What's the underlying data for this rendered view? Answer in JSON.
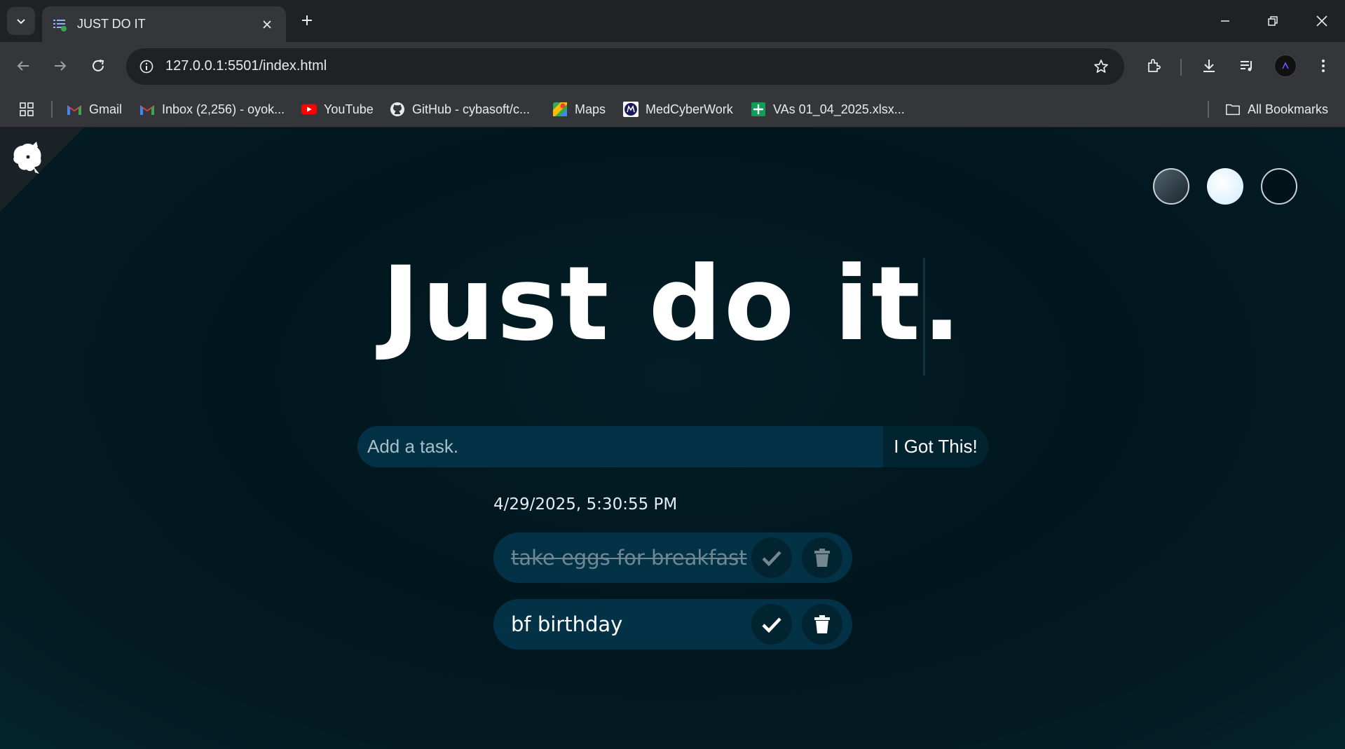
{
  "browser": {
    "tab_title": "JUST DO IT",
    "url": "127.0.0.1:5501/index.html",
    "bookmarks": [
      {
        "label": "Gmail",
        "icon": "gmail-icon"
      },
      {
        "label": "Inbox (2,256) - oyok...",
        "icon": "gmail-icon"
      },
      {
        "label": "YouTube",
        "icon": "youtube-icon"
      },
      {
        "label": "GitHub - cybasoft/c...",
        "icon": "github-icon"
      },
      {
        "label": "Maps",
        "icon": "maps-icon"
      },
      {
        "label": "MedCyberWork",
        "icon": "medcyberwork-icon"
      },
      {
        "label": "VAs 01_04_2025.xlsx...",
        "icon": "sheets-icon"
      }
    ],
    "all_bookmarks": "All Bookmarks"
  },
  "app": {
    "title": "Just do it.",
    "input_placeholder": "Add a task.",
    "submit_label": "I Got This!",
    "timestamp": "4/29/2025, 5:30:55 PM",
    "themes": [
      "standard",
      "light",
      "darker"
    ],
    "todos": [
      {
        "text": "take eggs for breakfast",
        "completed": true
      },
      {
        "text": "bf birthday",
        "completed": false
      }
    ]
  },
  "colors": {
    "page_bg": "#02161d",
    "input_bg": "#033246",
    "button_bg": "#022431"
  }
}
